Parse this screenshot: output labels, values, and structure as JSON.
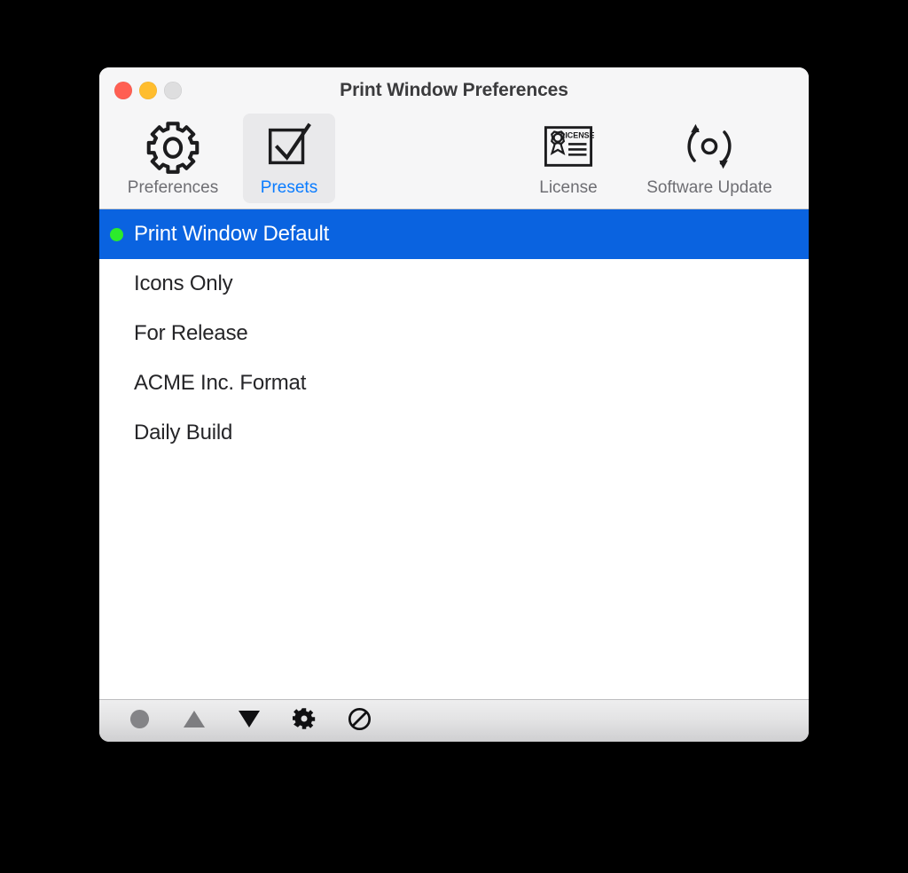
{
  "window": {
    "title": "Print Window Preferences",
    "traffic_lights": [
      {
        "name": "close",
        "color": "#ff5f52"
      },
      {
        "name": "minimize",
        "color": "#ffbd2e"
      },
      {
        "name": "zoom",
        "color": "#dededf"
      }
    ]
  },
  "toolbar": {
    "items": [
      {
        "id": "preferences",
        "label": "Preferences",
        "icon": "gear-icon",
        "selected": false
      },
      {
        "id": "presets",
        "label": "Presets",
        "icon": "checked-box-icon",
        "selected": true
      },
      {
        "id": "license",
        "label": "License",
        "icon": "certificate-icon",
        "selected": false
      },
      {
        "id": "software-update",
        "label": "Software Update",
        "icon": "refresh-arrows-icon",
        "selected": false
      }
    ],
    "selected_accent": "#0a7cff",
    "selected_background": "#e9e9eb"
  },
  "presets_list": {
    "selection_color": "#0a63e0",
    "active_dot_color": "#2ceb2c",
    "rows": [
      {
        "label": "Print Window Default",
        "selected": true,
        "active": true
      },
      {
        "label": "Icons Only",
        "selected": false,
        "active": false
      },
      {
        "label": "For Release",
        "selected": false,
        "active": false
      },
      {
        "label": "ACME Inc. Format",
        "selected": false,
        "active": false
      },
      {
        "label": "Daily Build",
        "selected": false,
        "active": false
      }
    ]
  },
  "bottom_bar": {
    "buttons": [
      {
        "id": "record",
        "icon": "filled-circle-icon",
        "enabled": false
      },
      {
        "id": "move-up",
        "icon": "triangle-up-icon",
        "enabled": false
      },
      {
        "id": "move-down",
        "icon": "triangle-down-icon",
        "enabled": true
      },
      {
        "id": "settings",
        "icon": "gear-icon",
        "enabled": true
      },
      {
        "id": "disable",
        "icon": "prohibition-icon",
        "enabled": true
      }
    ]
  }
}
